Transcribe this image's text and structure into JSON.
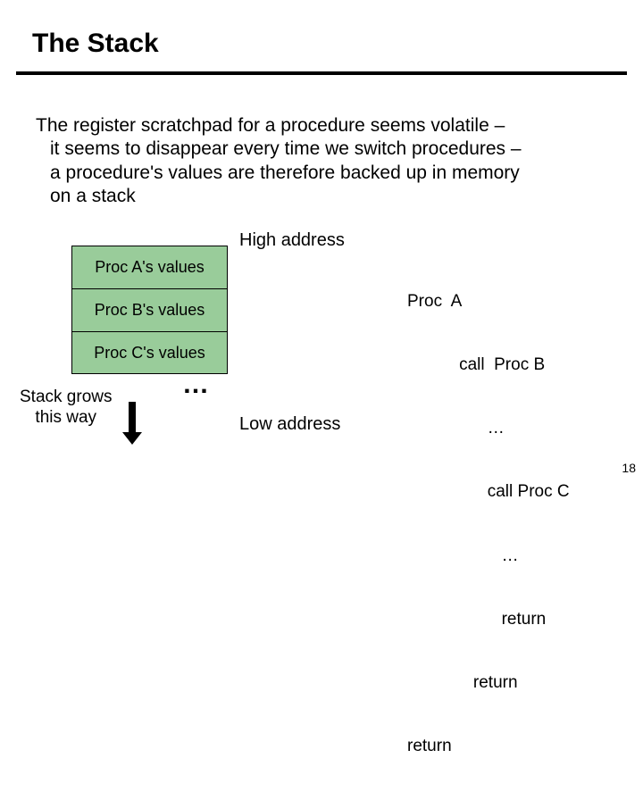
{
  "title": "The Stack",
  "body": {
    "l1": "The register scratchpad for a procedure seems volatile –",
    "l2": "it seems to disappear every time we switch procedures –",
    "l3": "a procedure's values are therefore backed up in memory",
    "l4": "on a stack"
  },
  "stack": {
    "cells": [
      "Proc A's  values",
      "Proc B's  values",
      "Proc C's  values"
    ],
    "ellipsis": "…"
  },
  "labels": {
    "high": "High address",
    "low": "Low address",
    "grow1": "Stack grows",
    "grow2": "this way"
  },
  "code": {
    "l1": "Proc  A",
    "l2": "           call  Proc B",
    "l3": "                 …",
    "l4": "                 call Proc C",
    "l5": "                    …",
    "l6": "                    return",
    "l7": "              return",
    "l8": "return"
  },
  "pagenum": "18"
}
